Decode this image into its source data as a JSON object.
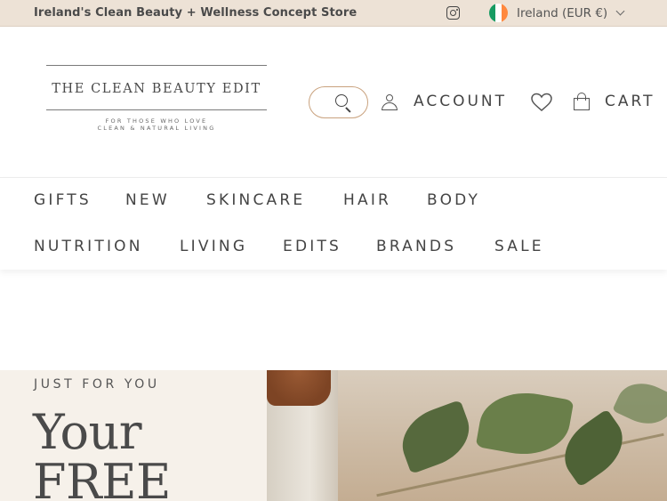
{
  "announcement": {
    "promo_text": "Ireland's Clean Beauty + Wellness Concept Store",
    "instagram_icon": "instagram-icon",
    "country_flag": "ireland-flag-icon",
    "country_selector": "Ireland (EUR €)"
  },
  "header": {
    "logo": {
      "name": "THE CLEAN BEAUTY EDIT",
      "tagline_line1": "FOR THOSE WHO LOVE",
      "tagline_line2": "CLEAN & NATURAL LIVING"
    },
    "search_icon": "search-icon",
    "account_label": "ACCOUNT",
    "wishlist_icon": "heart-icon",
    "cart_label": "CART"
  },
  "nav": {
    "row1": [
      "GIFTS",
      "NEW",
      "SKINCARE",
      "HAIR",
      "BODY"
    ],
    "row2": [
      "NUTRITION",
      "LIVING",
      "EDITS",
      "BRANDS",
      "SALE"
    ]
  },
  "hero": {
    "eyebrow": "JUST FOR YOU",
    "headline_line1": "Your",
    "headline_line2": "FREE"
  },
  "colors": {
    "topbar_bg": "#ede2d6",
    "search_border": "#c9a27e",
    "hero_panel_bg": "#f6f1ea",
    "text": "#444444"
  }
}
